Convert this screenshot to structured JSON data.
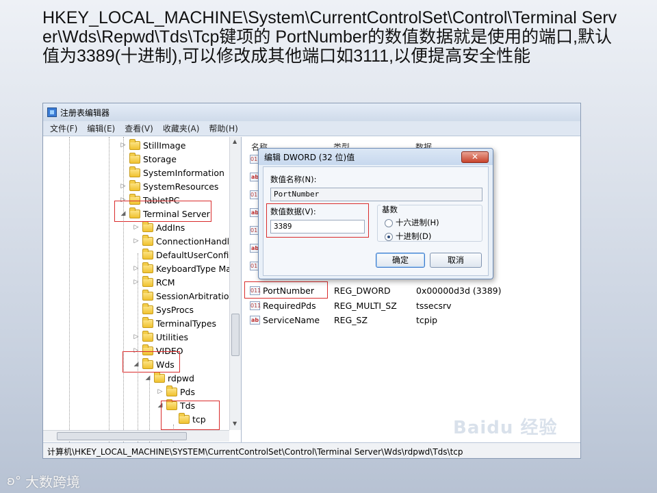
{
  "heading": "HKEY_LOCAL_MACHINE\\System\\CurrentControlSet\\Control\\Terminal Server\\Wds\\Repwd\\Tds\\Tcp键项的 PortNumber的数值数据就是使用的端口,默认值为3389(十进制),可以修改成其他端口如3111,以便提高安全性能",
  "window": {
    "title": "注册表编辑器",
    "menu": [
      "文件(F)",
      "编辑(E)",
      "查看(V)",
      "收藏夹(A)",
      "帮助(H)"
    ]
  },
  "tree": {
    "items": [
      {
        "label": "StillImage",
        "expander": "▷"
      },
      {
        "label": "Storage",
        "expander": ""
      },
      {
        "label": "SystemInformation",
        "expander": ""
      },
      {
        "label": "SystemResources",
        "expander": "▷"
      },
      {
        "label": "TabletPC",
        "expander": "▷"
      },
      {
        "label": "Terminal Server",
        "expander": "◢"
      },
      {
        "label": "AddIns",
        "expander": "▷"
      },
      {
        "label": "ConnectionHandler",
        "expander": "▷"
      },
      {
        "label": "DefaultUserConfig",
        "expander": ""
      },
      {
        "label": "KeyboardType Ma",
        "expander": "▷"
      },
      {
        "label": "RCM",
        "expander": "▷"
      },
      {
        "label": "SessionArbitrationI",
        "expander": ""
      },
      {
        "label": "SysProcs",
        "expander": ""
      },
      {
        "label": "TerminalTypes",
        "expander": ""
      },
      {
        "label": "Utilities",
        "expander": "▷"
      },
      {
        "label": "VIDEO",
        "expander": "▷"
      },
      {
        "label": "Wds",
        "expander": "◢"
      },
      {
        "label": "rdpwd",
        "expander": "◢"
      },
      {
        "label": "Pds",
        "expander": "▷"
      },
      {
        "label": "Tds",
        "expander": "◢"
      },
      {
        "label": "tcp",
        "expander": ""
      }
    ]
  },
  "values_pane": {
    "columns": [
      "名称",
      "类型",
      "数据"
    ],
    "rows": [
      {
        "name": "PortNumber",
        "type": "REG_DWORD",
        "data": "0x00000d3d (3389)",
        "icon": "dword-icon"
      },
      {
        "name": "RequiredPds",
        "type": "REG_MULTI_SZ",
        "data": "tssecsrv",
        "icon": "string-icon"
      },
      {
        "name": "ServiceName",
        "type": "REG_SZ",
        "data": "tcpip",
        "icon": "string-icon"
      }
    ]
  },
  "dialog": {
    "title": "编辑 DWORD (32 位)值",
    "close_label": "✕",
    "name_label": "数值名称(N):",
    "name_value": "PortNumber",
    "data_label": "数值数据(V):",
    "data_value": "3389",
    "base_label": "基数",
    "hex_label": "十六进制(H)",
    "dec_label": "十进制(D)",
    "selected_base": "decimal",
    "ok_label": "确定",
    "cancel_label": "取消"
  },
  "statusbar": "计算机\\HKEY_LOCAL_MACHINE\\SYSTEM\\CurrentControlSet\\Control\\Terminal Server\\Wds\\rdpwd\\Tds\\tcp",
  "watermark": "Baidu 经验",
  "footer_logo": "大数跨境",
  "colors": {
    "highlight_box": "#d92b2b",
    "accent": "#3a7bd5"
  }
}
